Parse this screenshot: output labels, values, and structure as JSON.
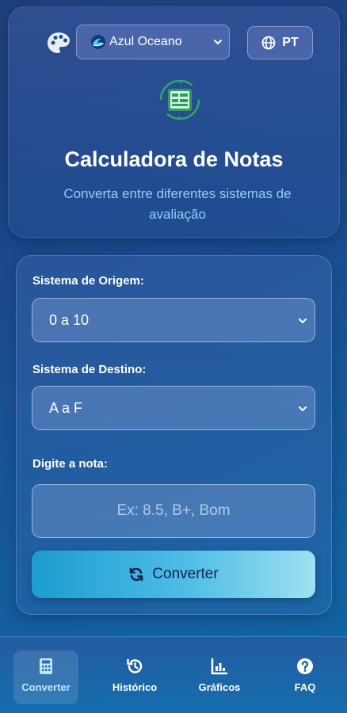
{
  "header": {
    "theme_selected": "Azul Oceano",
    "language": "PT",
    "title": "Calculadora de Notas",
    "subtitle": "Converta entre diferentes sistemas de avaliação"
  },
  "converter": {
    "origin_label": "Sistema de Origem:",
    "origin_value": "0 a 10",
    "destination_label": "Sistema de Destino:",
    "destination_value": "A a F",
    "input_label": "Digite a nota:",
    "input_placeholder": "Ex: 8.5, B+, Bom",
    "input_value": "",
    "convert_label": "Converter"
  },
  "nav": {
    "items": [
      {
        "label": "Converter",
        "icon": "calculator-icon",
        "active": true
      },
      {
        "label": "Histórico",
        "icon": "history-icon",
        "active": false
      },
      {
        "label": "Gráficos",
        "icon": "bar-chart-icon",
        "active": false
      },
      {
        "label": "FAQ",
        "icon": "question-icon",
        "active": false
      }
    ]
  },
  "colors": {
    "accent": "#4fbde6",
    "subtitle": "#8fd0f5",
    "background": "#1b4a8e"
  }
}
